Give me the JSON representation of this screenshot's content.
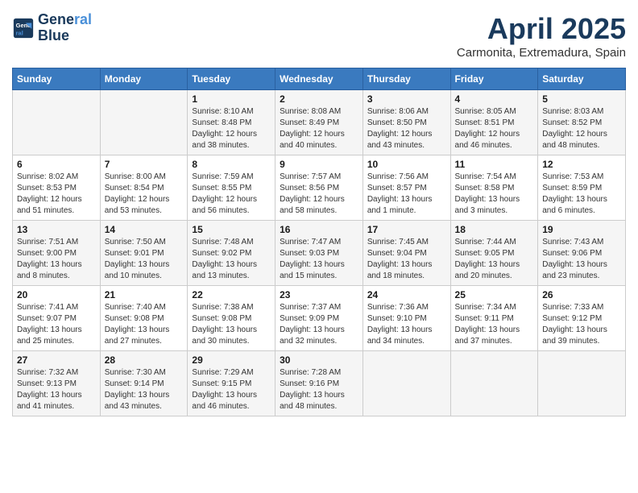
{
  "header": {
    "logo_line1": "General",
    "logo_line2": "Blue",
    "month_title": "April 2025",
    "subtitle": "Carmonita, Extremadura, Spain"
  },
  "weekdays": [
    "Sunday",
    "Monday",
    "Tuesday",
    "Wednesday",
    "Thursday",
    "Friday",
    "Saturday"
  ],
  "weeks": [
    [
      {
        "day": "",
        "info": ""
      },
      {
        "day": "",
        "info": ""
      },
      {
        "day": "1",
        "info": "Sunrise: 8:10 AM\nSunset: 8:48 PM\nDaylight: 12 hours\nand 38 minutes."
      },
      {
        "day": "2",
        "info": "Sunrise: 8:08 AM\nSunset: 8:49 PM\nDaylight: 12 hours\nand 40 minutes."
      },
      {
        "day": "3",
        "info": "Sunrise: 8:06 AM\nSunset: 8:50 PM\nDaylight: 12 hours\nand 43 minutes."
      },
      {
        "day": "4",
        "info": "Sunrise: 8:05 AM\nSunset: 8:51 PM\nDaylight: 12 hours\nand 46 minutes."
      },
      {
        "day": "5",
        "info": "Sunrise: 8:03 AM\nSunset: 8:52 PM\nDaylight: 12 hours\nand 48 minutes."
      }
    ],
    [
      {
        "day": "6",
        "info": "Sunrise: 8:02 AM\nSunset: 8:53 PM\nDaylight: 12 hours\nand 51 minutes."
      },
      {
        "day": "7",
        "info": "Sunrise: 8:00 AM\nSunset: 8:54 PM\nDaylight: 12 hours\nand 53 minutes."
      },
      {
        "day": "8",
        "info": "Sunrise: 7:59 AM\nSunset: 8:55 PM\nDaylight: 12 hours\nand 56 minutes."
      },
      {
        "day": "9",
        "info": "Sunrise: 7:57 AM\nSunset: 8:56 PM\nDaylight: 12 hours\nand 58 minutes."
      },
      {
        "day": "10",
        "info": "Sunrise: 7:56 AM\nSunset: 8:57 PM\nDaylight: 13 hours\nand 1 minute."
      },
      {
        "day": "11",
        "info": "Sunrise: 7:54 AM\nSunset: 8:58 PM\nDaylight: 13 hours\nand 3 minutes."
      },
      {
        "day": "12",
        "info": "Sunrise: 7:53 AM\nSunset: 8:59 PM\nDaylight: 13 hours\nand 6 minutes."
      }
    ],
    [
      {
        "day": "13",
        "info": "Sunrise: 7:51 AM\nSunset: 9:00 PM\nDaylight: 13 hours\nand 8 minutes."
      },
      {
        "day": "14",
        "info": "Sunrise: 7:50 AM\nSunset: 9:01 PM\nDaylight: 13 hours\nand 10 minutes."
      },
      {
        "day": "15",
        "info": "Sunrise: 7:48 AM\nSunset: 9:02 PM\nDaylight: 13 hours\nand 13 minutes."
      },
      {
        "day": "16",
        "info": "Sunrise: 7:47 AM\nSunset: 9:03 PM\nDaylight: 13 hours\nand 15 minutes."
      },
      {
        "day": "17",
        "info": "Sunrise: 7:45 AM\nSunset: 9:04 PM\nDaylight: 13 hours\nand 18 minutes."
      },
      {
        "day": "18",
        "info": "Sunrise: 7:44 AM\nSunset: 9:05 PM\nDaylight: 13 hours\nand 20 minutes."
      },
      {
        "day": "19",
        "info": "Sunrise: 7:43 AM\nSunset: 9:06 PM\nDaylight: 13 hours\nand 23 minutes."
      }
    ],
    [
      {
        "day": "20",
        "info": "Sunrise: 7:41 AM\nSunset: 9:07 PM\nDaylight: 13 hours\nand 25 minutes."
      },
      {
        "day": "21",
        "info": "Sunrise: 7:40 AM\nSunset: 9:08 PM\nDaylight: 13 hours\nand 27 minutes."
      },
      {
        "day": "22",
        "info": "Sunrise: 7:38 AM\nSunset: 9:08 PM\nDaylight: 13 hours\nand 30 minutes."
      },
      {
        "day": "23",
        "info": "Sunrise: 7:37 AM\nSunset: 9:09 PM\nDaylight: 13 hours\nand 32 minutes."
      },
      {
        "day": "24",
        "info": "Sunrise: 7:36 AM\nSunset: 9:10 PM\nDaylight: 13 hours\nand 34 minutes."
      },
      {
        "day": "25",
        "info": "Sunrise: 7:34 AM\nSunset: 9:11 PM\nDaylight: 13 hours\nand 37 minutes."
      },
      {
        "day": "26",
        "info": "Sunrise: 7:33 AM\nSunset: 9:12 PM\nDaylight: 13 hours\nand 39 minutes."
      }
    ],
    [
      {
        "day": "27",
        "info": "Sunrise: 7:32 AM\nSunset: 9:13 PM\nDaylight: 13 hours\nand 41 minutes."
      },
      {
        "day": "28",
        "info": "Sunrise: 7:30 AM\nSunset: 9:14 PM\nDaylight: 13 hours\nand 43 minutes."
      },
      {
        "day": "29",
        "info": "Sunrise: 7:29 AM\nSunset: 9:15 PM\nDaylight: 13 hours\nand 46 minutes."
      },
      {
        "day": "30",
        "info": "Sunrise: 7:28 AM\nSunset: 9:16 PM\nDaylight: 13 hours\nand 48 minutes."
      },
      {
        "day": "",
        "info": ""
      },
      {
        "day": "",
        "info": ""
      },
      {
        "day": "",
        "info": ""
      }
    ]
  ]
}
